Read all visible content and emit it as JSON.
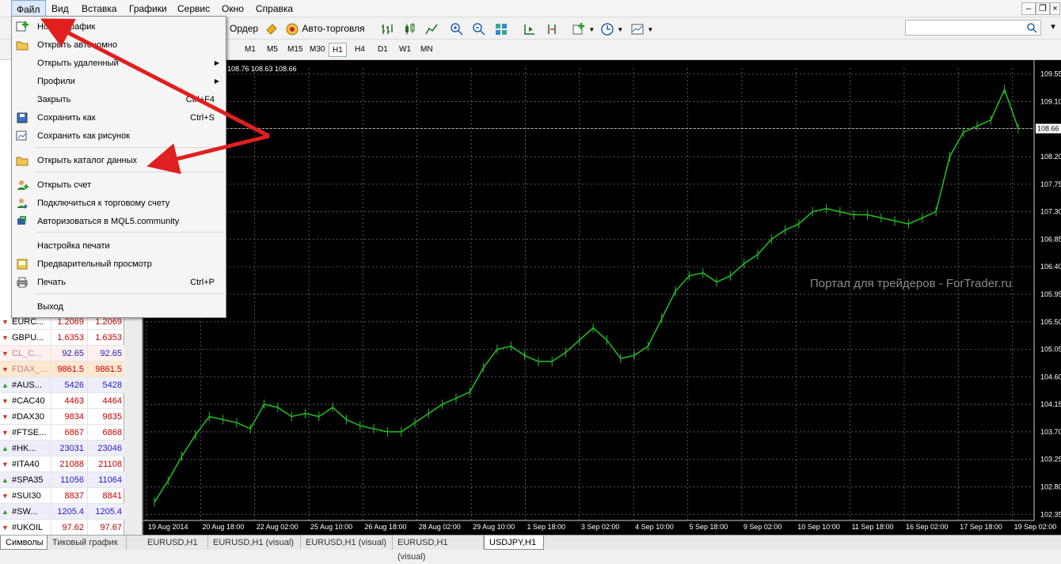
{
  "menubar": {
    "items": [
      "Файл",
      "Вид",
      "Вставка",
      "Графики",
      "Сервис",
      "Окно",
      "Справка"
    ]
  },
  "toolbar": {
    "order_label": "Ордер",
    "autotrade_label": "Авто-торговля"
  },
  "timeframes": [
    "M1",
    "M5",
    "M15",
    "M30",
    "H1",
    "H4",
    "D1",
    "W1",
    "MN"
  ],
  "active_timeframe": "H1",
  "file_menu": {
    "items": [
      {
        "label": "Новый график",
        "shortcut": "",
        "submenu": false,
        "icon": "new-chart-icon"
      },
      {
        "label": "Открыть автономно",
        "shortcut": "",
        "submenu": false,
        "icon": "open-folder-icon"
      },
      {
        "label": "Открыть удаленный",
        "shortcut": "",
        "submenu": true,
        "icon": ""
      },
      {
        "label": "Профили",
        "shortcut": "",
        "submenu": true,
        "icon": ""
      },
      {
        "label": "Закрыть",
        "shortcut": "Ctrl+F4",
        "submenu": false,
        "icon": ""
      },
      {
        "label": "Сохранить как",
        "shortcut": "Ctrl+S",
        "submenu": false,
        "icon": "save-icon"
      },
      {
        "label": "Сохранить как рисунок",
        "shortcut": "",
        "submenu": false,
        "icon": "save-image-icon"
      },
      {
        "label": "Открыть каталог данных",
        "shortcut": "",
        "submenu": false,
        "icon": "folder-icon"
      },
      {
        "label": "Открыть счет",
        "shortcut": "",
        "submenu": false,
        "icon": "open-account-icon"
      },
      {
        "label": "Подключиться к торговому счету",
        "shortcut": "",
        "submenu": false,
        "icon": "connect-icon"
      },
      {
        "label": "Авторизоваться в MQL5.community",
        "shortcut": "",
        "submenu": false,
        "icon": "mql5-icon"
      },
      {
        "label": "Настройка печати",
        "shortcut": "",
        "submenu": false,
        "icon": ""
      },
      {
        "label": "Предварительный просмотр",
        "shortcut": "",
        "submenu": false,
        "icon": "print-preview-icon"
      },
      {
        "label": "Печать",
        "shortcut": "Ctrl+P",
        "submenu": false,
        "icon": "print-icon"
      },
      {
        "label": "Выход",
        "shortcut": "",
        "submenu": false,
        "icon": ""
      }
    ]
  },
  "market_watch": {
    "rows": [
      {
        "symbol": "EURC...",
        "bid": "1.2069",
        "ask": "1.2069",
        "dir": "down",
        "color": "#c00000"
      },
      {
        "symbol": "GBPU...",
        "bid": "1.6353",
        "ask": "1.6353",
        "dir": "down",
        "color": "#c00000"
      },
      {
        "symbol": "CL_C...",
        "bid": "92.65",
        "ask": "92.65",
        "dir": "down",
        "color": "#2020c0",
        "muted": true
      },
      {
        "symbol": "FDAX_...",
        "bid": "9861.5",
        "ask": "9861.5",
        "dir": "down",
        "color": "#c00000",
        "muted": true
      },
      {
        "symbol": "#AUS...",
        "bid": "5426",
        "ask": "5428",
        "dir": "up",
        "color": "#2020c0"
      },
      {
        "symbol": "#CAC40",
        "bid": "4463",
        "ask": "4464",
        "dir": "down",
        "color": "#c00000"
      },
      {
        "symbol": "#DAX30",
        "bid": "9834",
        "ask": "9835",
        "dir": "down",
        "color": "#c00000"
      },
      {
        "symbol": "#FTSE...",
        "bid": "6867",
        "ask": "6868",
        "dir": "down",
        "color": "#c00000"
      },
      {
        "symbol": "#HK...",
        "bid": "23031",
        "ask": "23046",
        "dir": "up",
        "color": "#2020c0"
      },
      {
        "symbol": "#ITA40",
        "bid": "21088",
        "ask": "21108",
        "dir": "down",
        "color": "#c00000"
      },
      {
        "symbol": "#SPA35",
        "bid": "11056",
        "ask": "11064",
        "dir": "up",
        "color": "#2020c0"
      },
      {
        "symbol": "#SUI30",
        "bid": "8837",
        "ask": "8841",
        "dir": "down",
        "color": "#c00000"
      },
      {
        "symbol": "#SW...",
        "bid": "1205.4",
        "ask": "1205.4",
        "dir": "up",
        "color": "#2020c0"
      },
      {
        "symbol": "#UKOIL",
        "bid": "97.62",
        "ask": "97.67",
        "dir": "down",
        "color": "#c00000"
      }
    ],
    "tabs": [
      "Символы",
      "Тиковый график"
    ]
  },
  "chart_tabs": [
    "EURUSD,H1",
    "EURUSD,H1 (visual)",
    "EURUSD,H1 (visual)",
    "EURUSD,H1 (visual)",
    "USDJPY,H1"
  ],
  "active_chart_tab": "USDJPY,H1",
  "chart_header": "108.76 108.63 108.66",
  "watermark": "Портал для трейдеров - ForTrader.ru",
  "colors": {
    "candle": "#22c222",
    "background": "#000000",
    "grid": "#5a5a5a",
    "arrow": "#e02020"
  },
  "chart_data": {
    "type": "line",
    "title": "",
    "xlabel": "",
    "ylabel": "",
    "ylim": [
      102.25,
      109.65
    ],
    "x_ticks": [
      "19 Aug 2014",
      "20 Aug 18:00",
      "22 Aug 02:00",
      "25 Aug 10:00",
      "26 Aug 18:00",
      "28 Aug 02:00",
      "29 Aug 10:00",
      "1 Sep 18:00",
      "3 Sep 02:00",
      "4 Sep 10:00",
      "5 Sep 18:00",
      "9 Sep 02:00",
      "10 Sep 10:00",
      "11 Sep 18:00",
      "16 Sep 02:00",
      "17 Sep 18:00",
      "19 Sep 02:00"
    ],
    "y_ticks": [
      "109.55",
      "109.10",
      "108.66",
      "108.20",
      "107.75",
      "107.30",
      "106.85",
      "106.40",
      "105.95",
      "105.50",
      "105.05",
      "104.60",
      "104.15",
      "103.70",
      "103.25",
      "102.80",
      "102.35"
    ],
    "current_price": "108.66",
    "series": [
      {
        "values": [
          102.55,
          102.9,
          103.3,
          103.65,
          103.95,
          103.9,
          103.85,
          103.75,
          104.15,
          104.1,
          103.95,
          104.0,
          103.95,
          104.1,
          103.9,
          103.8,
          103.75,
          103.7,
          103.7,
          103.85,
          104.0,
          104.15,
          104.25,
          104.35,
          104.75,
          105.05,
          105.1,
          104.95,
          104.85,
          104.85,
          105.0,
          105.2,
          105.4,
          105.2,
          104.9,
          104.95,
          105.1,
          105.55,
          106.0,
          106.25,
          106.3,
          106.15,
          106.25,
          106.45,
          106.6,
          106.85,
          107.0,
          107.1,
          107.3,
          107.35,
          107.3,
          107.25,
          107.25,
          107.2,
          107.15,
          107.1,
          107.2,
          107.3,
          108.2,
          108.6,
          108.7,
          108.8,
          109.3,
          108.66
        ],
        "color": "#22c222"
      }
    ]
  }
}
